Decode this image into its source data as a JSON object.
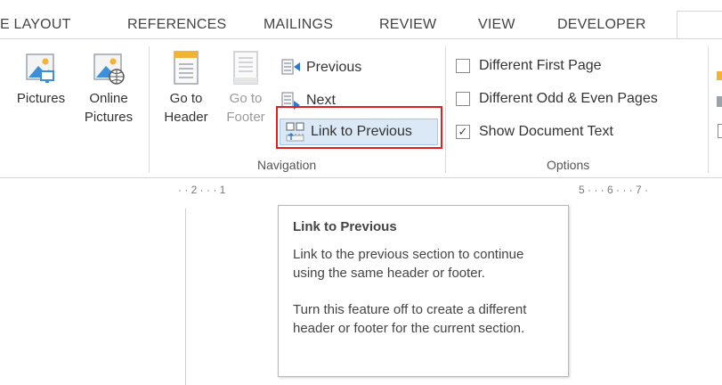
{
  "tabs": [
    "E LAYOUT",
    "REFERENCES",
    "MAILINGS",
    "REVIEW",
    "VIEW",
    "DEVELOPER"
  ],
  "insert": {
    "pictures_label": "Pictures",
    "online_pictures_line1": "Online",
    "online_pictures_line2": "Pictures"
  },
  "navigation": {
    "group_label": "Navigation",
    "go_to_header_line1": "Go to",
    "go_to_header_line2": "Header",
    "go_to_footer_line1": "Go to",
    "go_to_footer_line2": "Footer",
    "previous_label": "Previous",
    "next_label": "Next",
    "link_to_previous_label": "Link to Previous"
  },
  "options": {
    "group_label": "Options",
    "different_first_page": "Different First Page",
    "different_odd_even": "Different Odd & Even Pages",
    "show_document_text": "Show Document Text",
    "show_document_text_checked": true
  },
  "ruler": {
    "left_text": "· · 2 · · · 1",
    "right_text": "5 · · · 6 · · · 7 ·"
  },
  "tooltip": {
    "title": "Link to Previous",
    "para1": "Link to the previous section to continue using the same header or footer.",
    "para2": "Turn this feature off to create a different header or footer for the current section."
  },
  "colors": {
    "highlight_bg": "#dbe8f5",
    "annotation_red": "#e02020"
  }
}
